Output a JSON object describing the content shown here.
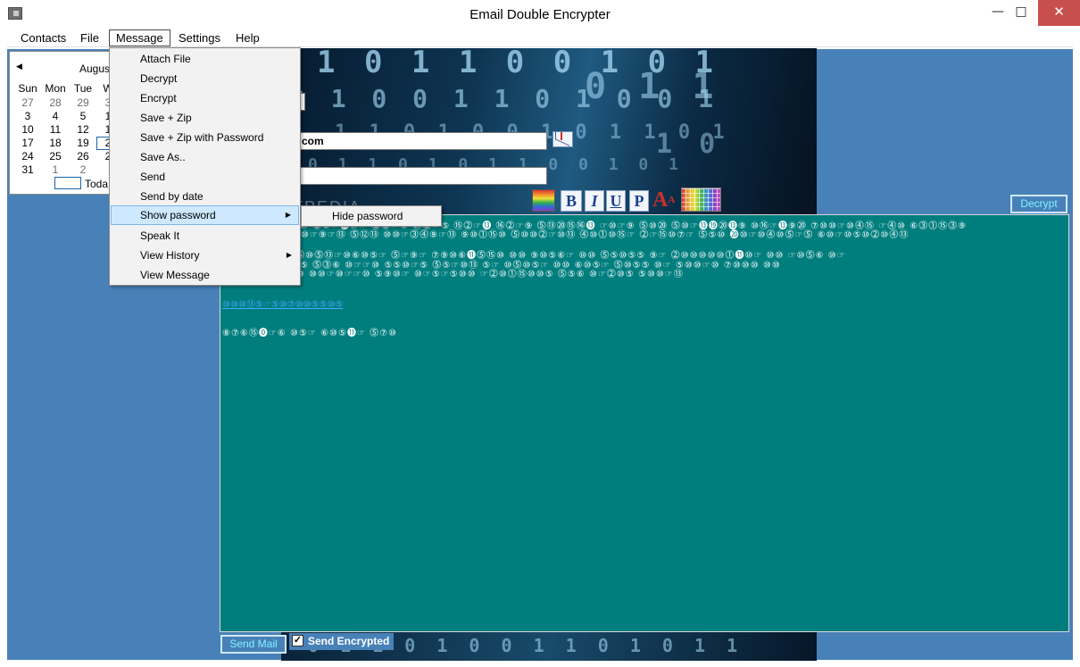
{
  "window": {
    "title": "Email Double Encrypter",
    "controls": {
      "minimize": "—",
      "maximize": "□",
      "close": "✕"
    }
  },
  "menubar": {
    "items": [
      {
        "label": "Contacts"
      },
      {
        "label": "File"
      },
      {
        "label": "Message"
      },
      {
        "label": "Settings"
      },
      {
        "label": "Help"
      }
    ]
  },
  "message_menu": {
    "items": [
      {
        "label": "Attach File"
      },
      {
        "label": "Decrypt"
      },
      {
        "label": "Encrypt"
      },
      {
        "label": "Save + Zip"
      },
      {
        "label": "Save + Zip with Password"
      },
      {
        "label": "Save As.."
      },
      {
        "label": "Send"
      },
      {
        "label": "Send by date"
      },
      {
        "label": "Show password"
      },
      {
        "label": "Speak It"
      },
      {
        "label": "View History"
      },
      {
        "label": "View Message"
      }
    ],
    "highlighted": "Show password",
    "submenu": {
      "items": [
        {
          "label": "Hide password"
        }
      ]
    }
  },
  "calendar": {
    "month": "August",
    "weekday_headers": [
      "Sun",
      "Mon",
      "Tue",
      "W"
    ],
    "rows": [
      [
        "27",
        "28",
        "29",
        "3"
      ],
      [
        "3",
        "4",
        "5",
        "1"
      ],
      [
        "10",
        "11",
        "12",
        "1"
      ],
      [
        "17",
        "18",
        "19",
        "2"
      ],
      [
        "24",
        "25",
        "26",
        "2"
      ],
      [
        "31",
        "1",
        "2",
        ""
      ]
    ],
    "today_label": "Toda"
  },
  "compose": {
    "to_value": "com",
    "subject_value": ""
  },
  "toolbar": {
    "bold": "B",
    "italic": "I",
    "underline": "U",
    "paragraph": "P",
    "font": "A",
    "font_sup": "A"
  },
  "buttons": {
    "decrypt": "Decrypt",
    "send_mail": "Send Mail",
    "send_encrypted": "Send Encrypted",
    "send_encrypted_checked": true
  },
  "body": {
    "encrypted_lines": [
      "⓵⑩☞⓹⑩ ⓴⑩☞⑩ ⓶⑨☞⓫⑩☞ ⓶⓶☞⑧ ⑳⓶☞⑤ ⑮⓶☞⓭ ⑯⓶☞⑨ ⓹⑬⑳⑮⑯⓭ ☞⑩☞⑨ ⓹⑩⑳ ⓹⑩☞⓭⓳⑳⓭⑨ ⑩⑯☞⓭⑨⑳ ⑦⑩⑩☞⑩⓸⑮ ☞⓸⑩ ⑥⓷⓵⑮⓷⑨",
      "⓵⑩☞⓹⑩ ⑩⓰⑮⑩☞⑨☞⑬ ⓹⑫⑬ ⑩⑩☞⓷⓸⑨☞⑬ ⑨⑩⓵⑮⑩ ⓹⑩⑩⓶☞⑩⑬ ⓸⑩⓵⑩⑮☞ ⓶☞⑮⑩⑦☞ ⓹⑤⑩ ⓴⑩☞⑩⓸⑩⓹☞⓹ ⑥⑩☞⑩⑤⑩⓶⑩⓸⑬",
      "⓹⑩ ⑮⓹⑤⑥ ⑮⓹⑩⓹⑬☞⑩⑥⑩⑤☞ ⓹☞⑨☞ ⑦⑨⑩⑥⓫⓹⑮⑩ ⑩⑩ ⑨⑩⑤⑥☞ ⑩⑩ ⓹⑤⑩⑤⑤ ⑨☞ ⓶⑩⑩⑩⑩⑩⓵⓫⑩☞ ⑩⑩ ☞⑩⓹⑥ ⑩☞",
      "⓹⑩⑩⓫⑮⑩ ⑩☞⑤ ⓹⓷⑥ ⑩☞☞⑩ ⑤⑤⑩☞⑤ ⓹⑤☞⑩⑬ ⑤☞ ⑩⓹⑩⑤☞ ⑩⑩ ⑥⑩⑤☞ ⓹⑩⑤⑤ ⑩☞ ⑤⑩⑩☞⑩ ⑦⑩⑩⑩ ⑩⑩",
      "⓹⑩⑩⑩⑬⓵⑩☞⑩ ⑩⑩☞⑩☞☞⑩ ⑤⑨⑩☞ ⑩☞⑤☞⑤⑩⑩ ☞⓶⑩⓵⑮⑩⑩⑤ ⓹⑤⑥ ⑩☞⓶⑩⑤ ⑤⑩⑩☞⑬"
    ],
    "link_line": "⑩⑩⑩⑬⑤☞⑤⑩⑦⑩⑩⑤⑤⑩⑤",
    "last_line": "⑧⑦⑥⑮⓿☞⑥ ⑩⑤☞ ⑥⑩⑤⓫☞ ⓹⑦⑩"
  },
  "watermark": "SOFTPEDIA"
}
